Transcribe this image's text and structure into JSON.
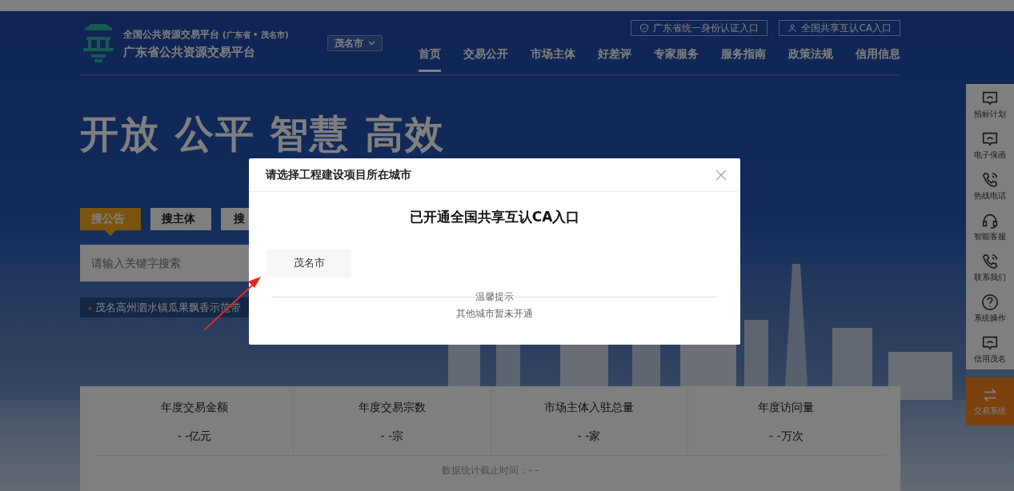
{
  "header": {
    "platform_title": "全国公共资源交易平台",
    "platform_region": "(广东省 • 茂名市)",
    "site_title": "广东省公共资源交易平台",
    "city_selector": "茂名市",
    "top_links": [
      {
        "label": "广东省统一身份认证入口",
        "kind": "shield"
      },
      {
        "label": "全国共享互认CA入口",
        "kind": "user"
      }
    ],
    "nav": [
      {
        "label": "首页",
        "selected": true
      },
      {
        "label": "交易公开",
        "selected": false
      },
      {
        "label": "市场主体",
        "selected": false
      },
      {
        "label": "好差评",
        "selected": false
      },
      {
        "label": "专家服务",
        "selected": false
      },
      {
        "label": "服务指南",
        "selected": false
      },
      {
        "label": "政策法规",
        "selected": false
      },
      {
        "label": "信用信息",
        "selected": false
      }
    ]
  },
  "hero": {
    "slogan": "开放 公平 智慧 高效",
    "search_tabs": [
      {
        "label": "搜公告",
        "selected": true
      },
      {
        "label": "搜主体",
        "selected": false
      },
      {
        "label": "搜",
        "selected": false
      }
    ],
    "search_placeholder": "请输入关键字搜索",
    "news_ticker": "茂名高州泗水镇瓜果飘香示范带"
  },
  "sidebar": {
    "items": [
      {
        "label": "招标计划",
        "kind": "chat",
        "selected": false
      },
      {
        "label": "电子保函",
        "kind": "chat",
        "selected": false
      },
      {
        "label": "热线电话",
        "kind": "phone",
        "selected": false
      },
      {
        "label": "智能客服",
        "kind": "headset",
        "selected": false
      },
      {
        "label": "联系我们",
        "kind": "phone",
        "selected": false
      },
      {
        "label": "系统操作",
        "kind": "help",
        "selected": false
      },
      {
        "label": "信用茂名",
        "kind": "chat",
        "selected": false
      },
      {
        "label": "交易系统",
        "kind": "exchange",
        "selected": true
      }
    ]
  },
  "stats": {
    "items": [
      {
        "label": "年度交易金额",
        "value": "- -亿元"
      },
      {
        "label": "年度交易宗数",
        "value": "- -宗"
      },
      {
        "label": "市场主体入驻总量",
        "value": "- -家"
      },
      {
        "label": "年度访问量",
        "value": "- -万次"
      }
    ],
    "footer": "数据统计截止时间：- -"
  },
  "modal": {
    "title": "请选择工程建设项目所在城市",
    "heading": "已开通全国共享互认CA入口",
    "cities": [
      {
        "label": "茂名市"
      }
    ],
    "notice_title": "温馨提示",
    "notice_text": "其他城市暂未开通"
  }
}
